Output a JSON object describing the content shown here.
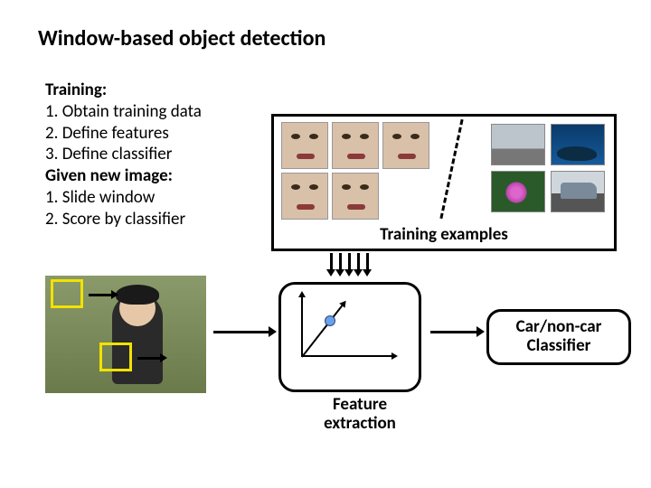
{
  "title": "Window-based object detection",
  "text": {
    "training_heading": "Training:",
    "training_step1": "1. Obtain training data",
    "training_step2": "2. Define features",
    "training_step3": "3. Define classifier",
    "given_heading": "Given new image:",
    "given_step1": "1. Slide window",
    "given_step2": "2. Score by classifier"
  },
  "training_examples_label": "Training examples",
  "feature_label_line1": "Feature",
  "feature_label_line2": "extraction",
  "classifier_label_line1": "Car/non-car",
  "classifier_label_line2": "Classifier"
}
